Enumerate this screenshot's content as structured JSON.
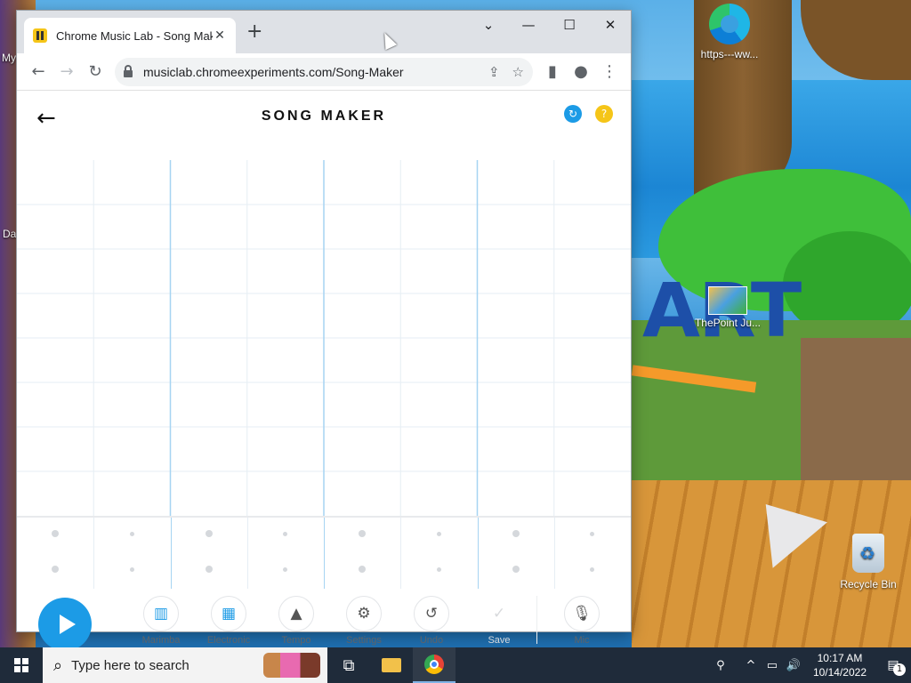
{
  "desktop": {
    "icons": [
      {
        "label": "https---ww..."
      },
      {
        "label": "ThePoint Ju..."
      },
      {
        "label": "Recycle Bin"
      }
    ],
    "left_labels": [
      "My",
      "Da"
    ],
    "wallpaper_text": "ART"
  },
  "browser": {
    "tab": {
      "title": "Chrome Music Lab - Song Maker",
      "close": "✕"
    },
    "newtab": "+",
    "window_controls": {
      "dropdown": "⌄",
      "minimize": "—",
      "maximize": "☐",
      "close": "✕"
    },
    "url": "musiclab.chromeexperiments.com/Song-Maker",
    "icons": {
      "back": "←",
      "forward": "→",
      "reload": "↻",
      "share": "⇪",
      "star": "☆",
      "sidepanel": "▮",
      "profile": "●",
      "menu": "⋮"
    }
  },
  "songmaker": {
    "title": "SONG MAKER",
    "back": "←",
    "refresh_icon": "↻",
    "help_icon": "?",
    "play_label": "Play",
    "controls": [
      {
        "label": "Marimba",
        "icon": "▥"
      },
      {
        "label": "Electronic",
        "icon": "▦"
      },
      {
        "label": "Tempo",
        "icon": "▲"
      },
      {
        "label": "Settings",
        "icon": "⚙"
      },
      {
        "label": "Undo",
        "icon": "↺"
      },
      {
        "label": "Save",
        "icon": "✓"
      },
      {
        "label": "Mic",
        "icon": "🎙"
      }
    ]
  },
  "taskbar": {
    "search_placeholder": "Type here to search",
    "search_icon": "⌕",
    "taskview_icon": "⧉",
    "time": "10:17 AM",
    "date": "10/14/2022",
    "tray_icons": {
      "people": "⚲",
      "chevron": "^",
      "network": "▭",
      "volume": "🔊"
    },
    "notification_icon": "▤",
    "notification_count": "1"
  },
  "colors": {
    "accent": "#1c9be6",
    "grid_line": "#e6eef4",
    "grid_bar": "#a6d4f2",
    "refresh": "#1c9be6",
    "help": "#f5c518"
  }
}
